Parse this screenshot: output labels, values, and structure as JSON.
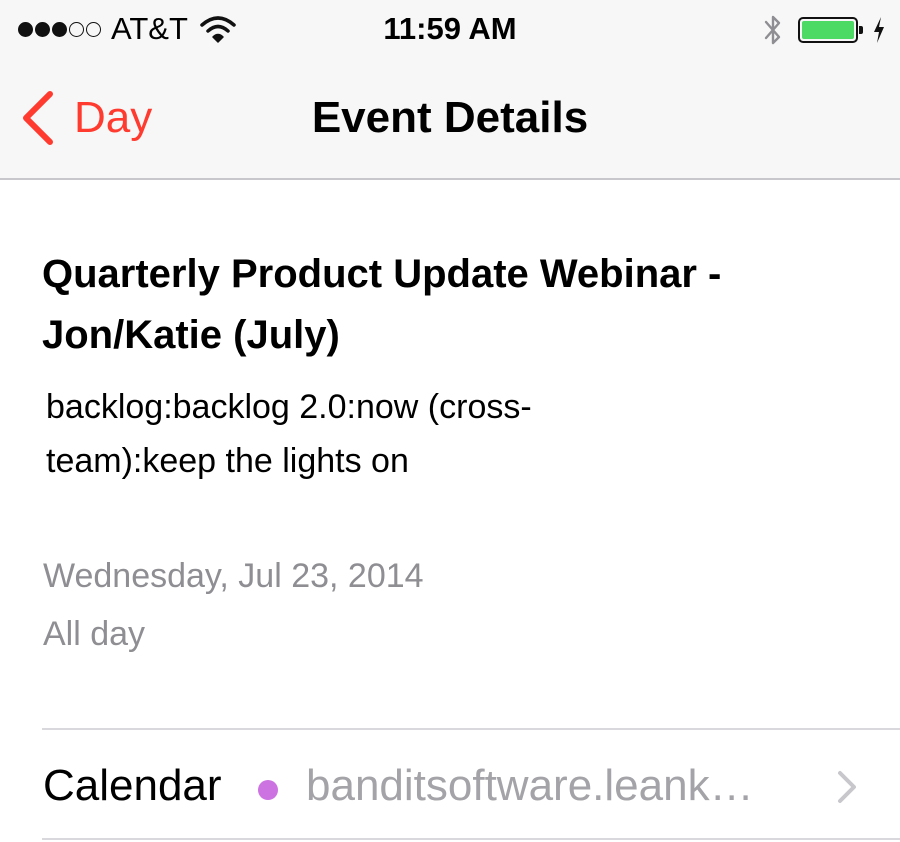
{
  "status_bar": {
    "signal_dots_filled": 3,
    "signal_dots_total": 5,
    "carrier": "AT&T",
    "time": "11:59 AM",
    "battery_level": 1.0,
    "battery_color": "#4cd964"
  },
  "nav": {
    "back_label": "Day",
    "title": "Event Details",
    "accent_color": "#ff3b30"
  },
  "event": {
    "title": "Quarterly Product Update Webinar - Jon/Katie (July)",
    "notes": "backlog:backlog 2.0:now (cross-team):keep the lights on",
    "date": "Wednesday, Jul 23, 2014",
    "time": "All day"
  },
  "calendar_row": {
    "label": "Calendar",
    "value": "banditsoftware.leank…",
    "dot_color": "#cc73e1"
  },
  "icons": {
    "back": "chevron-left-icon",
    "wifi": "wifi-icon",
    "bluetooth": "bluetooth-icon",
    "battery": "battery-icon",
    "charging": "charging-bolt-icon",
    "disclosure": "chevron-right-icon"
  }
}
